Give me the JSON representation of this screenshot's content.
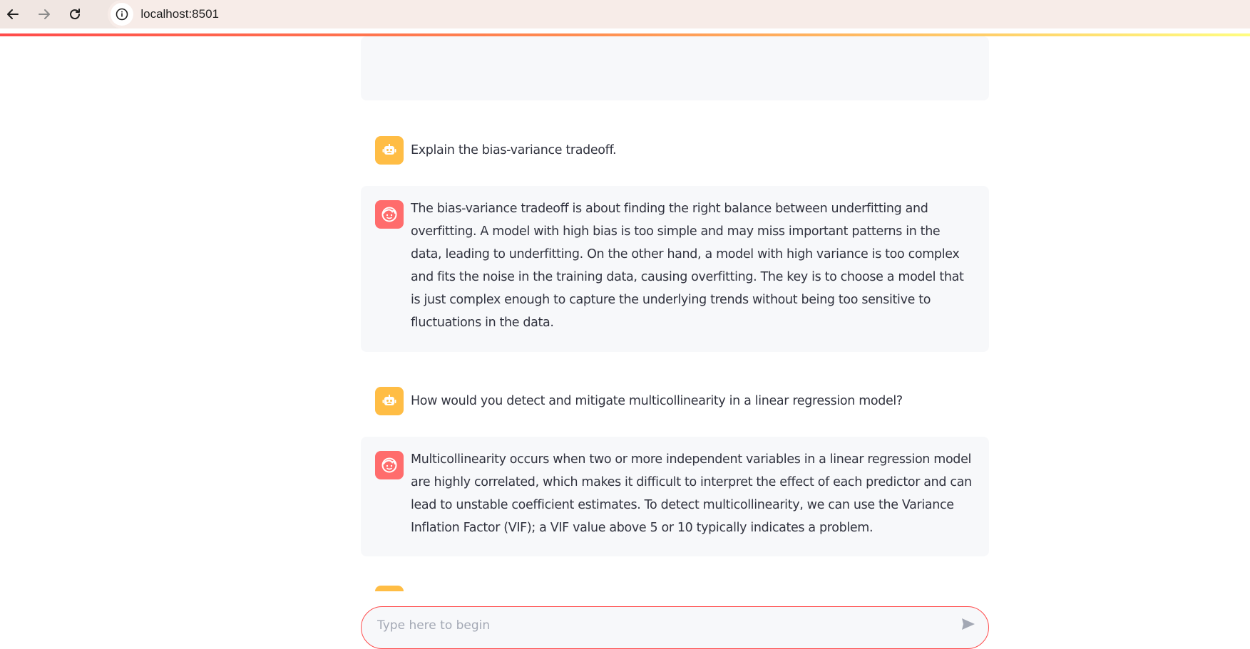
{
  "browser": {
    "url": "localhost:8501"
  },
  "chat": {
    "messages": [
      {
        "role": "bot",
        "text": "Explain the bias-variance tradeoff."
      },
      {
        "role": "user",
        "text": "The bias-variance tradeoff is about finding the right balance between underfitting and overfitting. A model with high bias is too simple and may miss important patterns in the data, leading to underfitting. On the other hand, a model with high variance is too complex and fits the noise in the training data, causing overfitting. The key is to choose a model that is just complex enough to capture the underlying trends without being too sensitive to fluctuations in the data."
      },
      {
        "role": "bot",
        "text": "How would you detect and mitigate multicollinearity in a linear regression model?"
      },
      {
        "role": "user",
        "text": "Multicollinearity occurs when two or more independent variables in a linear regression model are highly correlated, which makes it difficult to interpret the effect of each predictor and can lead to unstable coefficient estimates. To detect multicollinearity, we can use the Variance Inflation Factor (VIF); a VIF value above 5 or 10 typically indicates a problem."
      }
    ],
    "input_placeholder": "Type here to begin"
  },
  "colors": {
    "bot_avatar": "#ffbd45",
    "user_avatar": "#ff6c6c",
    "assistant_bg": "#f7f8fa",
    "accent": "#ff4b4b"
  },
  "icons": {
    "back": "arrow-left-icon",
    "forward": "arrow-right-icon",
    "reload": "reload-icon",
    "site_info": "info-icon",
    "bot_avatar": "robot-icon",
    "user_avatar": "face-icon",
    "send": "send-icon"
  }
}
